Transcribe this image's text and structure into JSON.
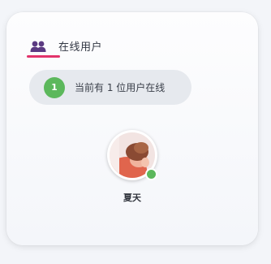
{
  "panel": {
    "title": "在线用户",
    "header_icon": "users-icon",
    "accent_color": "#e2336b"
  },
  "status": {
    "count": "1",
    "text": "当前有 1 位用户在线",
    "badge_color": "#5cb85c"
  },
  "users": [
    {
      "name": "夏天",
      "online": true,
      "status_color": "#5cb85c"
    }
  ]
}
